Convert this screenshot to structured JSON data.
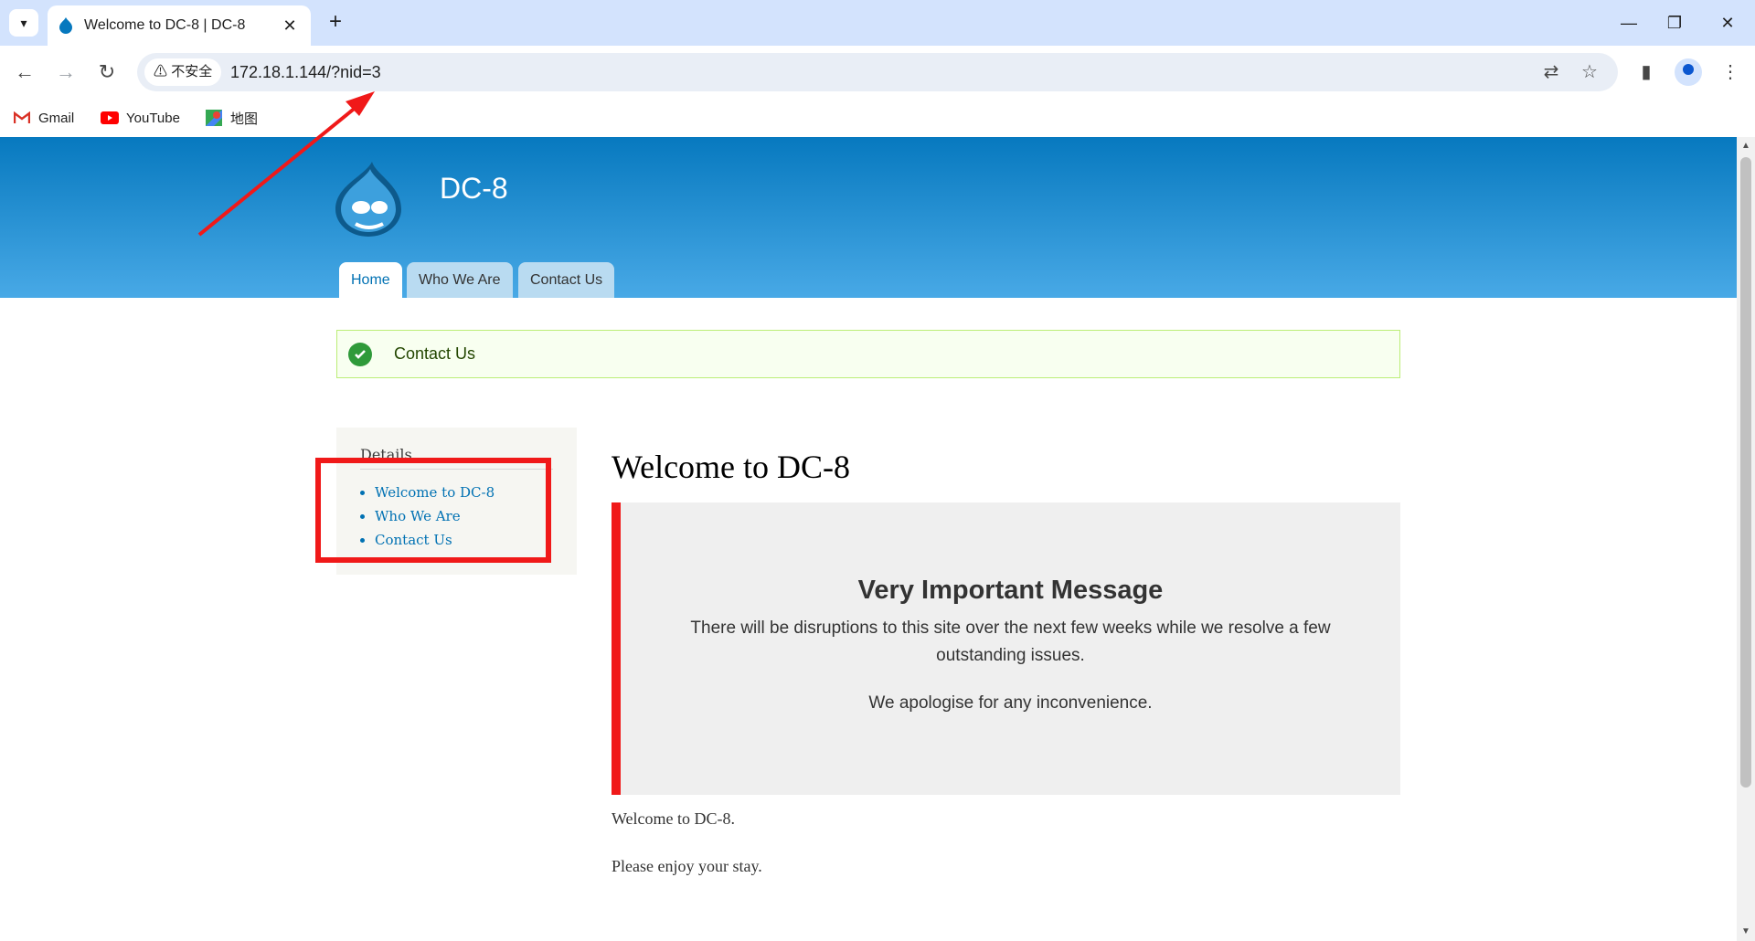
{
  "browser": {
    "tab_title": "Welcome to DC-8 | DC-8",
    "security_label": "不安全",
    "url": "172.18.1.144/?nid=3",
    "bookmarks": [
      {
        "label": "Gmail",
        "icon": "gmail-icon"
      },
      {
        "label": "YouTube",
        "icon": "youtube-icon"
      },
      {
        "label": "地图",
        "icon": "maps-icon"
      }
    ]
  },
  "site": {
    "name": "DC-8",
    "nav": [
      "Home",
      "Who We Are",
      "Contact Us"
    ],
    "status_message": "Contact Us",
    "sidebar": {
      "title": "Details",
      "links": [
        "Welcome to DC-8",
        "Who We Are",
        "Contact Us"
      ]
    },
    "content": {
      "title": "Welcome to DC-8",
      "notice_title": "Very Important Message",
      "notice_text": "There will be disruptions to this site over the next few weeks while we resolve a few outstanding issues.",
      "notice_text2": "We apologise for any inconvenience.",
      "para1": "Welcome to DC-8.",
      "para2": "Please enjoy your stay."
    }
  },
  "colors": {
    "header_top": "#0779bf",
    "header_bottom": "#48a9e6",
    "annotation": "#f01919",
    "notice_bar": "#f01919"
  }
}
